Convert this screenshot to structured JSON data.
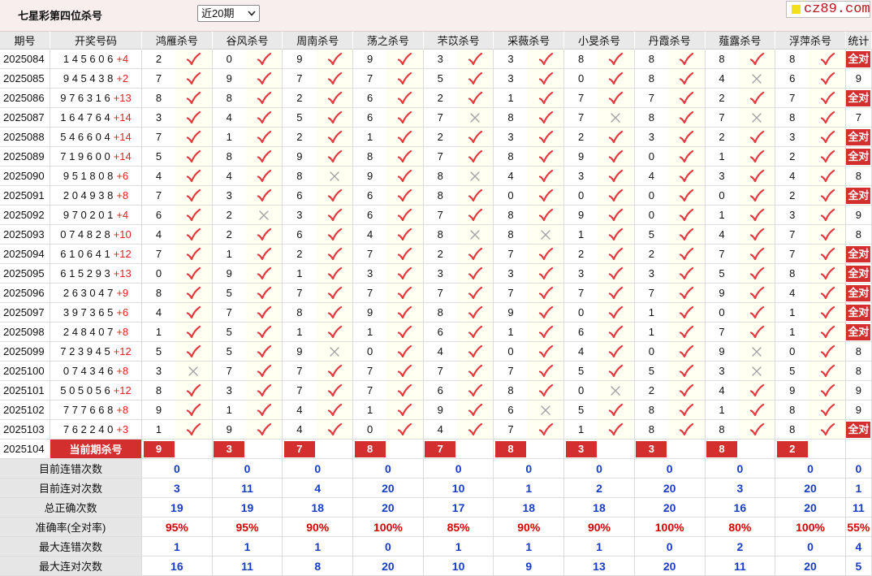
{
  "header": {
    "title": "七星彩第四位杀号",
    "period_select": "近20期",
    "logo_text": "cz89.com"
  },
  "columns": {
    "period": "期号",
    "numbers": "开奖号码",
    "experts": [
      "鸿雁杀号",
      "谷风杀号",
      "周南杀号",
      "荡之杀号",
      "芣苡杀号",
      "采薇杀号",
      "小旻杀号",
      "丹霞杀号",
      "薤露杀号",
      "浮萍杀号"
    ],
    "stat": "统计"
  },
  "rows": [
    {
      "period": "2025084",
      "numbers": "1 4 5 6 0 6",
      "bonus": "+4",
      "kills": [
        2,
        0,
        9,
        9,
        3,
        3,
        8,
        8,
        8,
        8
      ],
      "correct": [
        true,
        true,
        true,
        true,
        true,
        true,
        true,
        true,
        true,
        true
      ],
      "stat": "全对"
    },
    {
      "period": "2025085",
      "numbers": "9 4 5 4 3 8",
      "bonus": "+2",
      "kills": [
        7,
        9,
        7,
        7,
        5,
        3,
        0,
        8,
        4,
        6
      ],
      "correct": [
        true,
        true,
        true,
        true,
        true,
        true,
        true,
        true,
        false,
        true
      ],
      "stat": 9
    },
    {
      "period": "2025086",
      "numbers": "9 7 6 3 1 6",
      "bonus": "+13",
      "kills": [
        8,
        8,
        2,
        6,
        2,
        1,
        7,
        7,
        2,
        7
      ],
      "correct": [
        true,
        true,
        true,
        true,
        true,
        true,
        true,
        true,
        true,
        true
      ],
      "stat": "全对"
    },
    {
      "period": "2025087",
      "numbers": "1 6 4 7 6 4",
      "bonus": "+14",
      "kills": [
        3,
        4,
        5,
        6,
        7,
        8,
        7,
        8,
        7,
        8
      ],
      "correct": [
        true,
        true,
        true,
        true,
        false,
        true,
        false,
        true,
        false,
        true
      ],
      "stat": 7
    },
    {
      "period": "2025088",
      "numbers": "5 4 6 6 0 4",
      "bonus": "+14",
      "kills": [
        7,
        1,
        2,
        1,
        2,
        3,
        2,
        3,
        2,
        3
      ],
      "correct": [
        true,
        true,
        true,
        true,
        true,
        true,
        true,
        true,
        true,
        true
      ],
      "stat": "全对"
    },
    {
      "period": "2025089",
      "numbers": "7 1 9 6 0 0",
      "bonus": "+14",
      "kills": [
        5,
        8,
        9,
        8,
        7,
        8,
        9,
        0,
        1,
        2
      ],
      "correct": [
        true,
        true,
        true,
        true,
        true,
        true,
        true,
        true,
        true,
        true
      ],
      "stat": "全对"
    },
    {
      "period": "2025090",
      "numbers": "9 5 1 8 0 8",
      "bonus": "+6",
      "kills": [
        4,
        4,
        8,
        9,
        8,
        4,
        3,
        4,
        3,
        4
      ],
      "correct": [
        true,
        true,
        false,
        true,
        false,
        true,
        true,
        true,
        true,
        true
      ],
      "stat": 8
    },
    {
      "period": "2025091",
      "numbers": "2 0 4 9 3 8",
      "bonus": "+8",
      "kills": [
        7,
        3,
        6,
        6,
        8,
        0,
        0,
        0,
        0,
        2
      ],
      "correct": [
        true,
        true,
        true,
        true,
        true,
        true,
        true,
        true,
        true,
        true
      ],
      "stat": "全对"
    },
    {
      "period": "2025092",
      "numbers": "9 7 0 2 0 1",
      "bonus": "+4",
      "kills": [
        6,
        2,
        3,
        6,
        7,
        8,
        9,
        0,
        1,
        3
      ],
      "correct": [
        true,
        false,
        true,
        true,
        true,
        true,
        true,
        true,
        true,
        true
      ],
      "stat": 9
    },
    {
      "period": "2025093",
      "numbers": "0 7 4 8 2 8",
      "bonus": "+10",
      "kills": [
        4,
        2,
        6,
        4,
        8,
        8,
        1,
        5,
        4,
        7
      ],
      "correct": [
        true,
        true,
        true,
        true,
        false,
        false,
        true,
        true,
        true,
        true
      ],
      "stat": 8
    },
    {
      "period": "2025094",
      "numbers": "6 1 0 6 4 1",
      "bonus": "+12",
      "kills": [
        7,
        1,
        2,
        7,
        2,
        7,
        2,
        2,
        7,
        7
      ],
      "correct": [
        true,
        true,
        true,
        true,
        true,
        true,
        true,
        true,
        true,
        true
      ],
      "stat": "全对"
    },
    {
      "period": "2025095",
      "numbers": "6 1 5 2 9 3",
      "bonus": "+13",
      "kills": [
        0,
        9,
        1,
        3,
        3,
        3,
        3,
        3,
        5,
        8
      ],
      "correct": [
        true,
        true,
        true,
        true,
        true,
        true,
        true,
        true,
        true,
        true
      ],
      "stat": "全对"
    },
    {
      "period": "2025096",
      "numbers": "2 6 3 0 4 7",
      "bonus": "+9",
      "kills": [
        8,
        5,
        7,
        7,
        7,
        7,
        7,
        7,
        9,
        4
      ],
      "correct": [
        true,
        true,
        true,
        true,
        true,
        true,
        true,
        true,
        true,
        true
      ],
      "stat": "全对"
    },
    {
      "period": "2025097",
      "numbers": "3 9 7 3 6 5",
      "bonus": "+6",
      "kills": [
        4,
        7,
        8,
        9,
        8,
        9,
        0,
        1,
        0,
        1
      ],
      "correct": [
        true,
        true,
        true,
        true,
        true,
        true,
        true,
        true,
        true,
        true
      ],
      "stat": "全对"
    },
    {
      "period": "2025098",
      "numbers": "2 4 8 4 0 7",
      "bonus": "+8",
      "kills": [
        1,
        5,
        1,
        1,
        6,
        1,
        6,
        1,
        7,
        1
      ],
      "correct": [
        true,
        true,
        true,
        true,
        true,
        true,
        true,
        true,
        true,
        true
      ],
      "stat": "全对"
    },
    {
      "period": "2025099",
      "numbers": "7 2 3 9 4 5",
      "bonus": "+12",
      "kills": [
        5,
        5,
        9,
        0,
        4,
        0,
        4,
        0,
        9,
        0
      ],
      "correct": [
        true,
        true,
        false,
        true,
        true,
        true,
        true,
        true,
        false,
        true
      ],
      "stat": 8
    },
    {
      "period": "2025100",
      "numbers": "0 7 4 3 4 6",
      "bonus": "+8",
      "kills": [
        3,
        7,
        7,
        7,
        7,
        7,
        5,
        5,
        3,
        5
      ],
      "correct": [
        false,
        true,
        true,
        true,
        true,
        true,
        true,
        true,
        false,
        true
      ],
      "stat": 8
    },
    {
      "period": "2025101",
      "numbers": "5 0 5 0 5 6",
      "bonus": "+12",
      "kills": [
        8,
        3,
        7,
        7,
        6,
        8,
        0,
        2,
        4,
        9
      ],
      "correct": [
        true,
        true,
        true,
        true,
        true,
        true,
        false,
        true,
        true,
        true
      ],
      "stat": 9
    },
    {
      "period": "2025102",
      "numbers": "7 7 7 6 6 8",
      "bonus": "+8",
      "kills": [
        9,
        1,
        4,
        1,
        9,
        6,
        5,
        8,
        1,
        8
      ],
      "correct": [
        true,
        true,
        true,
        true,
        true,
        false,
        true,
        true,
        true,
        true
      ],
      "stat": 9
    },
    {
      "period": "2025103",
      "numbers": "7 6 2 2 4 0",
      "bonus": "+3",
      "kills": [
        1,
        9,
        4,
        0,
        4,
        7,
        1,
        8,
        8,
        8
      ],
      "correct": [
        true,
        true,
        true,
        true,
        true,
        true,
        true,
        true,
        true,
        true
      ],
      "stat": "全对"
    }
  ],
  "current": {
    "period": "2025104",
    "label": "当前期杀号",
    "kills": [
      9,
      3,
      7,
      8,
      7,
      8,
      3,
      3,
      8,
      2
    ]
  },
  "stats": [
    {
      "label": "目前连错次数",
      "values": [
        0,
        0,
        0,
        0,
        0,
        0,
        0,
        0,
        0,
        0
      ],
      "total": 0
    },
    {
      "label": "目前连对次数",
      "values": [
        3,
        11,
        4,
        20,
        10,
        1,
        2,
        20,
        3,
        20
      ],
      "total": 1
    },
    {
      "label": "总正确次数",
      "values": [
        19,
        19,
        18,
        20,
        17,
        18,
        18,
        20,
        16,
        20
      ],
      "total": 11
    },
    {
      "label": "准确率(全对率)",
      "values": [
        "95%",
        "95%",
        "90%",
        "100%",
        "85%",
        "90%",
        "90%",
        "100%",
        "80%",
        "100%"
      ],
      "total": "55%"
    },
    {
      "label": "最大连错次数",
      "values": [
        1,
        1,
        1,
        0,
        1,
        1,
        1,
        0,
        2,
        0
      ],
      "total": 4
    },
    {
      "label": "最大连对次数",
      "values": [
        16,
        11,
        8,
        20,
        10,
        9,
        13,
        20,
        11,
        20
      ],
      "total": 5
    }
  ],
  "icons": {
    "correct": "check-icon",
    "wrong": "cross-icon",
    "dropdown": "chevron-down-icon"
  },
  "colors": {
    "check": "#e8383d",
    "cross": "#a3a3a3",
    "badge": "#d32f2f",
    "summary_value": "#1a3cc7",
    "accuracy": "#d50000",
    "bonus": "#e02424",
    "logo_text": "#b3141c",
    "logo_square": "#f3e01c"
  }
}
